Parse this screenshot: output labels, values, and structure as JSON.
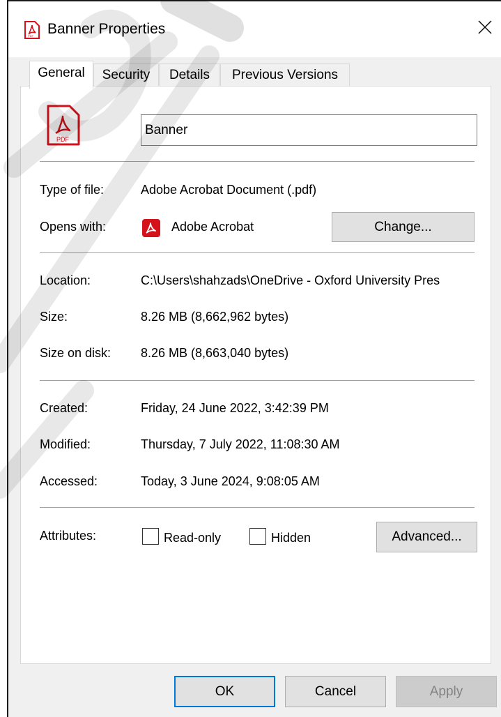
{
  "window": {
    "title": "Banner Properties"
  },
  "tabs": [
    {
      "label": "General",
      "active": true
    },
    {
      "label": "Security",
      "active": false
    },
    {
      "label": "Details",
      "active": false
    },
    {
      "label": "Previous Versions",
      "active": false
    }
  ],
  "file": {
    "icon_label": "PDF",
    "name": "Banner"
  },
  "type_row": {
    "label": "Type of file:",
    "value": "Adobe Acrobat Document (.pdf)"
  },
  "opens_row": {
    "label": "Opens with:",
    "value": "Adobe Acrobat",
    "change_label": "Change..."
  },
  "location_row": {
    "label": "Location:",
    "value": "C:\\Users\\shahzads\\OneDrive - Oxford University Pres"
  },
  "size_row": {
    "label": "Size:",
    "value": "8.26 MB (8,662,962 bytes)"
  },
  "size_on_disk_row": {
    "label": "Size on disk:",
    "value": "8.26 MB (8,663,040 bytes)"
  },
  "created_row": {
    "label": "Created:",
    "value": "Friday, 24 June 2022, 3:42:39 PM"
  },
  "modified_row": {
    "label": "Modified:",
    "value": "Thursday, 7 July 2022, 11:08:30 AM"
  },
  "accessed_row": {
    "label": "Accessed:",
    "value": "Today, 3 June 2024, 9:08:05 AM"
  },
  "attributes": {
    "label": "Attributes:",
    "readonly_label": "Read-only",
    "readonly_checked": false,
    "hidden_label": "Hidden",
    "hidden_checked": false,
    "advanced_label": "Advanced..."
  },
  "footer": {
    "ok_label": "OK",
    "cancel_label": "Cancel",
    "apply_label": "Apply",
    "apply_enabled": false
  },
  "colors": {
    "acrobat_red": "#d4121c",
    "primary_button_border": "#0078d7",
    "watermark": "#000000"
  }
}
